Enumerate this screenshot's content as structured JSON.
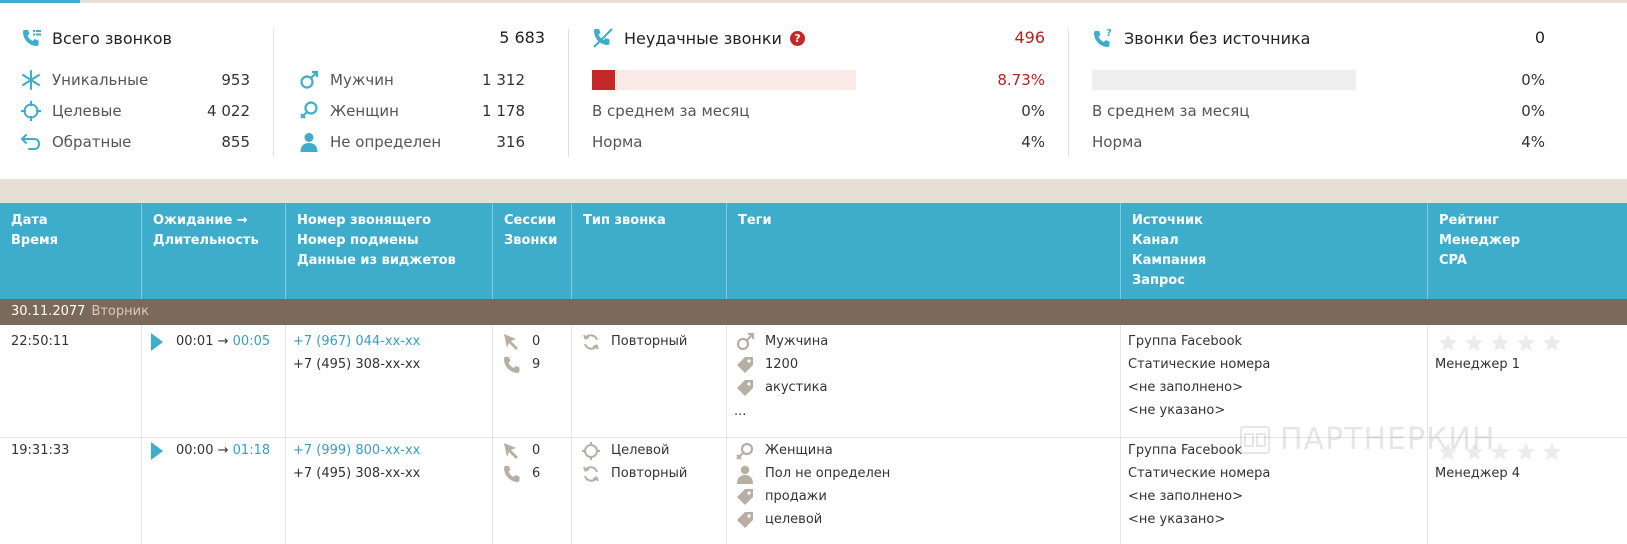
{
  "summary": {
    "total": {
      "title": "Всего звонков",
      "value": "5 683",
      "rows": [
        {
          "label": "Уникальные",
          "value": "953"
        },
        {
          "label": "Целевые",
          "value": "4 022"
        },
        {
          "label": "Обратные",
          "value": "855"
        }
      ],
      "gender_rows": [
        {
          "label": "Мужчин",
          "value": "1 312"
        },
        {
          "label": "Женщин",
          "value": "1 178"
        },
        {
          "label": "Не определен",
          "value": "316"
        }
      ]
    },
    "failed": {
      "title": "Неудачные звонки",
      "help": "?",
      "value": "496",
      "percent": "8.73%",
      "percent_fraction": 0.0873,
      "avg_label": "В среднем за месяц",
      "avg_value": "0%",
      "norm_label": "Норма",
      "norm_value": "4%"
    },
    "no_source": {
      "title": "Звонки без источника",
      "value": "0",
      "percent": "0%",
      "percent_fraction": 0,
      "avg_label": "В среднем за месяц",
      "avg_value": "0%",
      "norm_label": "Норма",
      "norm_value": "4%"
    }
  },
  "table": {
    "headers": {
      "date": [
        "Дата",
        "Время"
      ],
      "wait": [
        "Ожидание →",
        "Длительность"
      ],
      "number": [
        "Номер звонящего",
        "Номер подмены",
        "Данные из виджетов"
      ],
      "sessions": [
        "Сессии",
        "Звонки"
      ],
      "type": [
        "Тип звонка"
      ],
      "tags": [
        "Теги"
      ],
      "source": [
        "Источник",
        "Канал",
        "Кампания",
        "Запрос"
      ],
      "rating": [
        "Рейтинг",
        "Менеджер",
        "CPA"
      ]
    },
    "day": {
      "date": "30.11.2077",
      "weekday": "Вторник"
    },
    "rows": [
      {
        "time": "22:50:11",
        "wait": "00:01",
        "arrow": "→",
        "duration": "00:05",
        "caller": "+7 (967) 044-xx-xx",
        "substitute": "+7 (495) 308-xx-xx",
        "sessions": "0",
        "calls": "9",
        "types": [
          {
            "icon": "repeat-icon",
            "label": "Повторный"
          }
        ],
        "tags": [
          {
            "icon": "male-icon",
            "label": "Мужчина"
          },
          {
            "icon": "tag-icon",
            "label": "1200"
          },
          {
            "icon": "tag-icon",
            "label": "акустика"
          }
        ],
        "tags_more": "...",
        "source": "Группа Facebook",
        "channel": "Статические номера",
        "campaign": "<не заполнено>",
        "query": "<не указано>",
        "rating": 0,
        "manager": "Менеджер 1"
      },
      {
        "time": "19:31:33",
        "wait": "00:00",
        "arrow": "→",
        "duration": "01:18",
        "caller": "+7 (999) 800-xx-xx",
        "substitute": "+7 (495) 308-xx-xx",
        "sessions": "0",
        "calls": "6",
        "types": [
          {
            "icon": "target-icon",
            "label": "Целевой"
          },
          {
            "icon": "repeat-icon",
            "label": "Повторный"
          }
        ],
        "tags": [
          {
            "icon": "female-icon",
            "label": "Женщина"
          },
          {
            "icon": "person-icon",
            "label": "Пол не определен"
          },
          {
            "icon": "tag-icon",
            "label": "продажи"
          },
          {
            "icon": "tag-icon",
            "label": "целевой"
          }
        ],
        "tags_more": "",
        "source": "Группа Facebook",
        "channel": "Статические номера",
        "campaign": "<не заполнено>",
        "query": "<не указано>",
        "rating": 0,
        "manager": "Менеджер 4"
      }
    ]
  },
  "watermark": "ПАРТНЕРКИН",
  "colors": {
    "accent": "#3eadcc",
    "danger": "#c62828",
    "day_bar": "#7b6a5b",
    "band": "#e6dfd6"
  }
}
